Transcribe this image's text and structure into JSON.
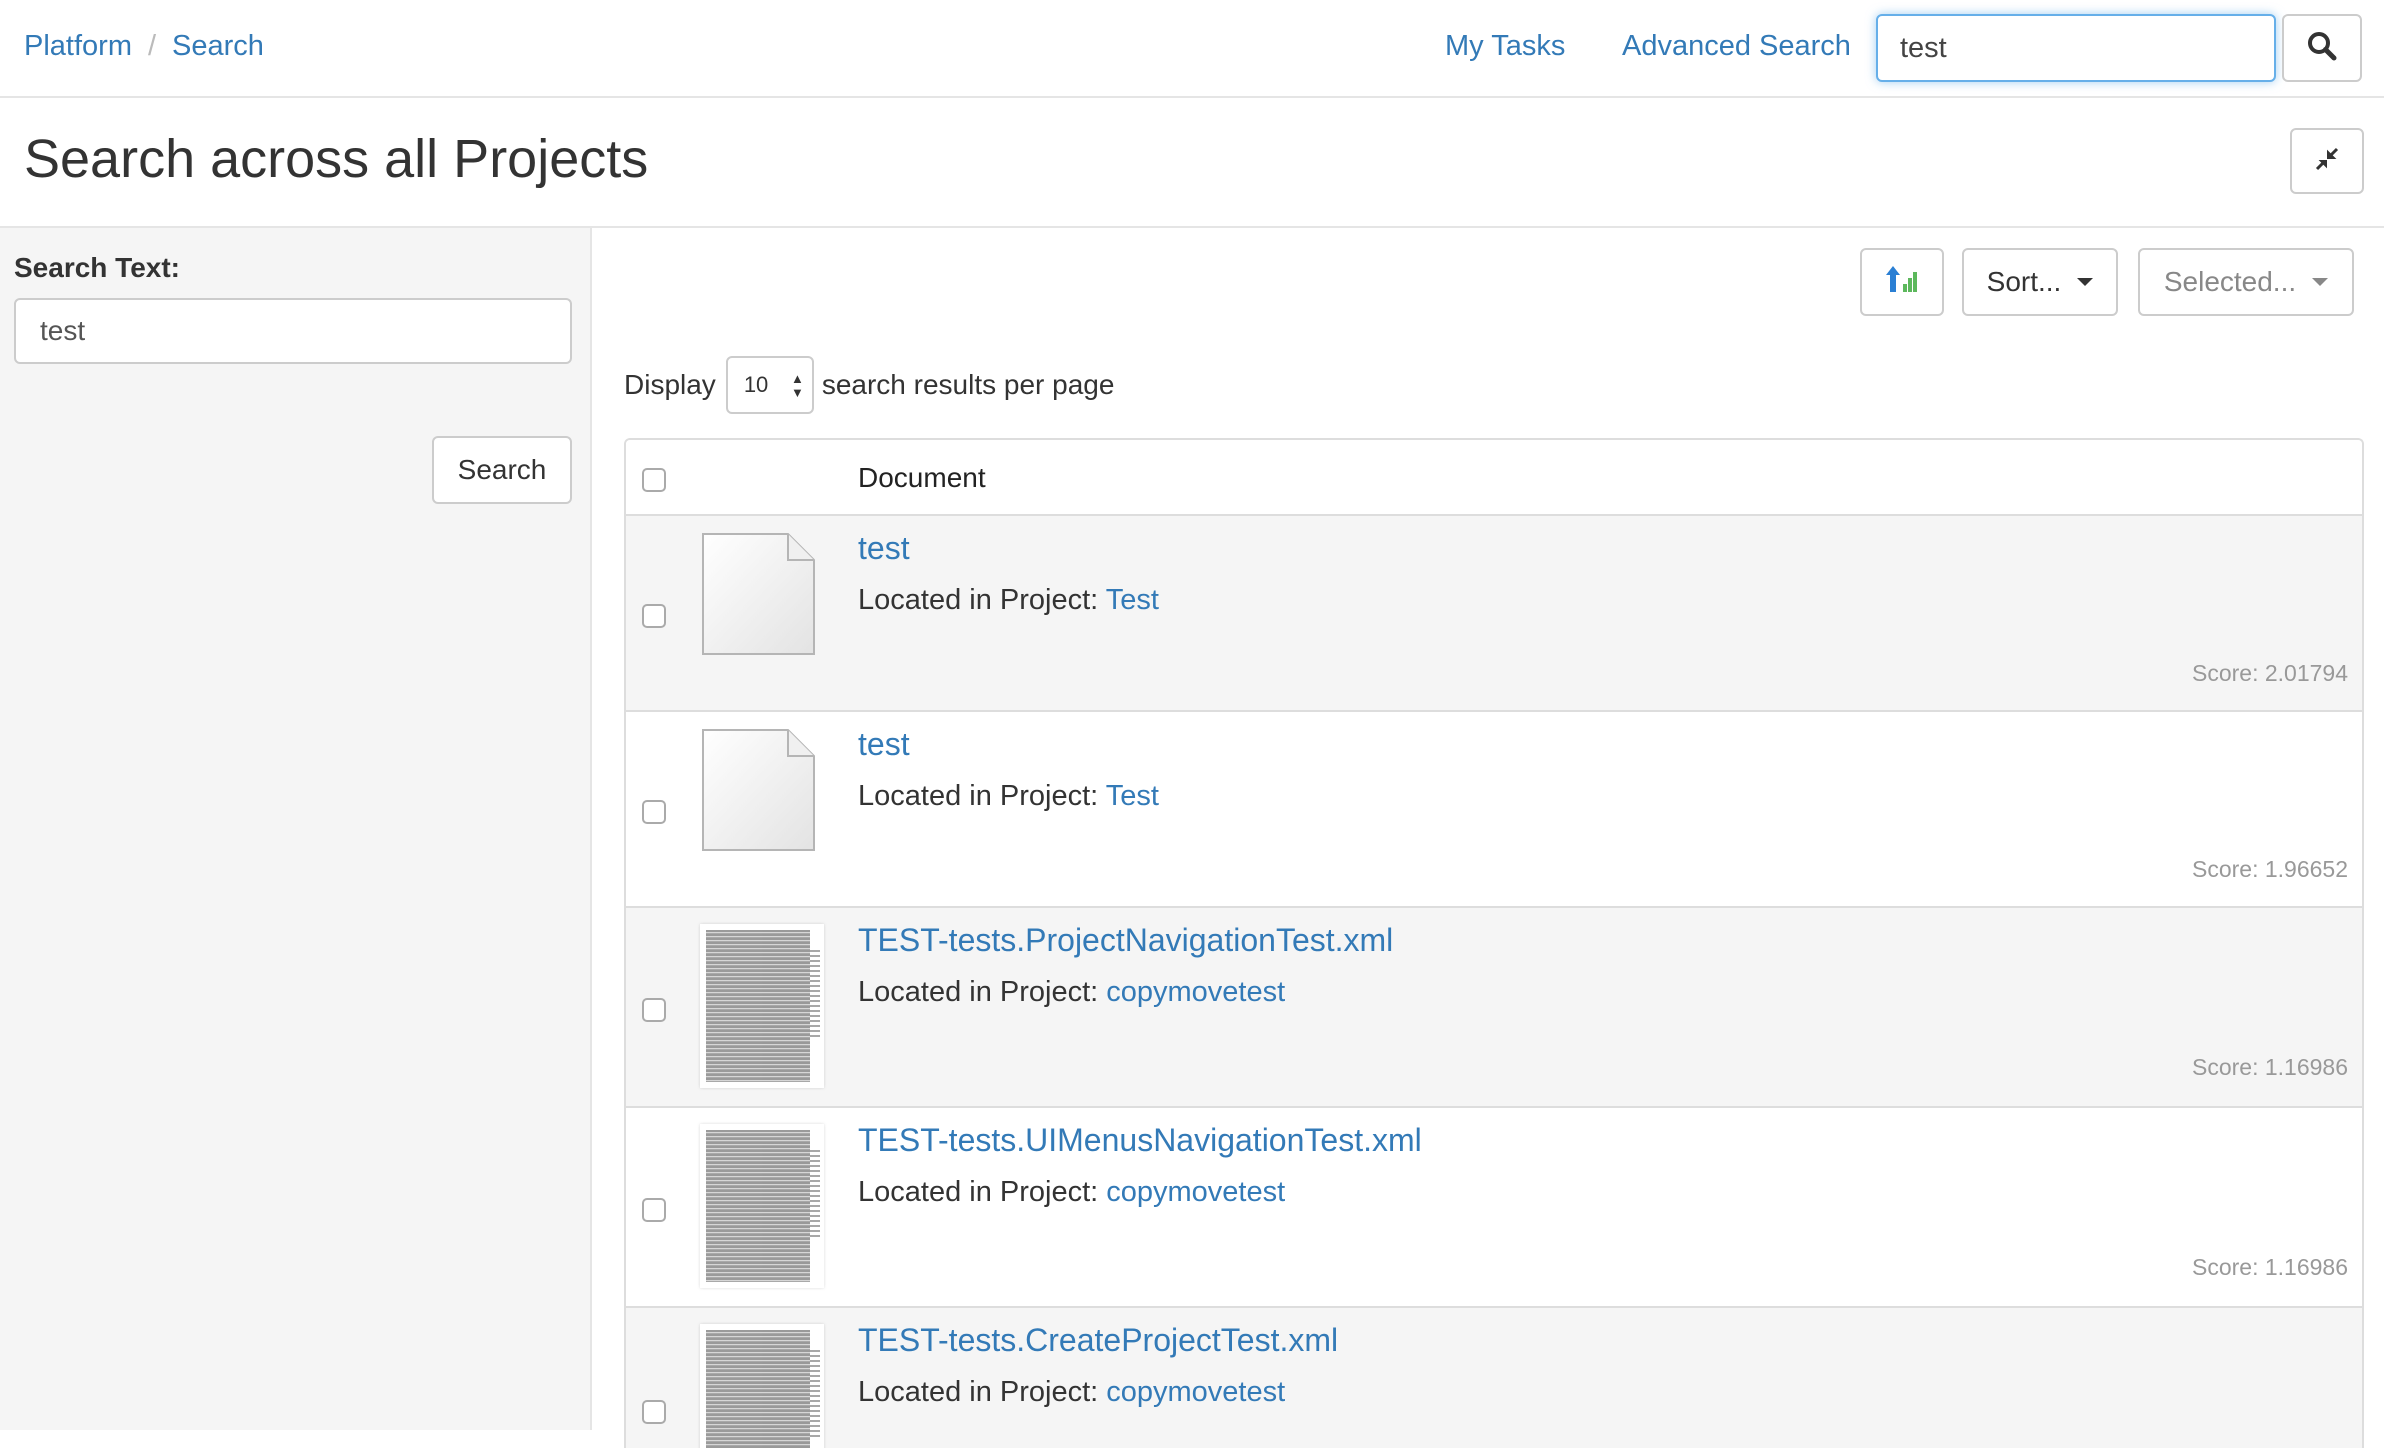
{
  "breadcrumb": {
    "root": "Platform",
    "separator": "/",
    "current": "Search"
  },
  "nav": {
    "my_tasks": "My Tasks",
    "advanced_search": "Advanced Search"
  },
  "top_search": {
    "value": "test"
  },
  "page": {
    "title": "Search across all Projects"
  },
  "sidebar": {
    "label": "Search Text:",
    "value": "test",
    "button": "Search"
  },
  "toolbar": {
    "sort": "Sort...",
    "selected": "Selected..."
  },
  "display": {
    "prefix": "Display",
    "per_page": "10",
    "suffix": "search results per page"
  },
  "results": {
    "column_header": "Document",
    "located_prefix": "Located in Project:",
    "items": [
      {
        "title": "test",
        "project": "Test",
        "score": "Score: 2.01794",
        "thumbnail": "blank-document-icon"
      },
      {
        "title": "test",
        "project": "Test",
        "score": "Score: 1.96652",
        "thumbnail": "blank-document-icon"
      },
      {
        "title": "TEST-tests.ProjectNavigationTest.xml",
        "project": "copymovetest",
        "score": "Score: 1.16986",
        "thumbnail": "xml-preview"
      },
      {
        "title": "TEST-tests.UIMenusNavigationTest.xml",
        "project": "copymovetest",
        "score": "Score: 1.16986",
        "thumbnail": "xml-preview"
      },
      {
        "title": "TEST-tests.CreateProjectTest.xml",
        "project": "copymovetest",
        "score": "",
        "thumbnail": "xml-preview"
      }
    ]
  },
  "colors": {
    "link": "#337ab7",
    "focus_border": "#66afe9",
    "sidebar_bg": "#f5f5f5",
    "row_alt_bg": "#f5f5f5"
  }
}
